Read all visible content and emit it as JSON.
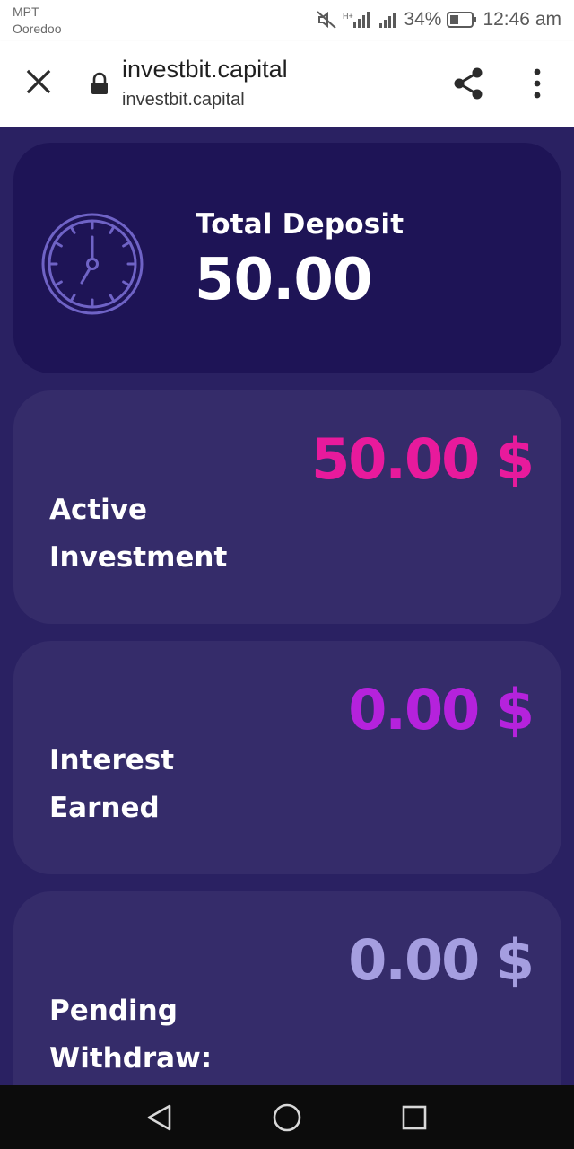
{
  "status_bar": {
    "carrier_line1": "MPT",
    "carrier_line2": "Ooredoo",
    "battery": "34%",
    "time": "12:46 am"
  },
  "browser": {
    "title": "investbit.capital",
    "url": "investbit.capital"
  },
  "cards": {
    "deposit": {
      "label": "Total Deposit",
      "value": "50.00"
    },
    "active": {
      "amount": "50.00 $",
      "label_line1": "Active",
      "label_line2": "Investment",
      "color": "#e81a9c"
    },
    "interest": {
      "amount": "0.00 $",
      "label_line1": "Interest",
      "label_line2": "Earned",
      "color": "#b522dc"
    },
    "pending": {
      "amount": "0.00 $",
      "label_line1": "Pending",
      "label_line2": "Withdraw:",
      "color": "#a59ee0"
    }
  },
  "colors": {
    "page_bg": "#2a2162",
    "deposit_card_bg": "#1e1456",
    "card_bg": "#352c6a"
  },
  "icons": [
    "close-icon",
    "lock-icon",
    "share-icon",
    "more-vert-icon",
    "clock-icon",
    "back-icon",
    "home-icon",
    "recents-icon"
  ]
}
